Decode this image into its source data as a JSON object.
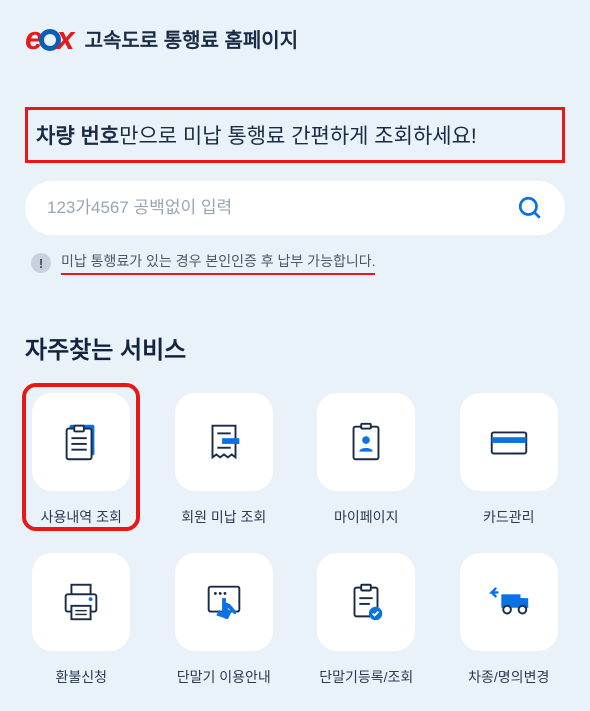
{
  "header": {
    "site_title": "고속도로 통행료 홈페이지"
  },
  "headline": {
    "bold_part": "차량 번호",
    "rest": "만으로 미납 통행료 간편하게 조회하세요!"
  },
  "search": {
    "placeholder": "123가4567 공백없이 입력"
  },
  "notice": {
    "badge": "!",
    "text": "미납 통행료가 있는 경우 본인인증 후 납부 가능합니다."
  },
  "section_title": "자주찾는 서비스",
  "services": [
    {
      "label": "사용내역 조회"
    },
    {
      "label": "회원 미납 조회"
    },
    {
      "label": "마이페이지"
    },
    {
      "label": "카드관리"
    },
    {
      "label": "환불신청"
    },
    {
      "label": "단말기 이용안내"
    },
    {
      "label": "단말기등록/조회"
    },
    {
      "label": "차종/명의변경"
    }
  ]
}
